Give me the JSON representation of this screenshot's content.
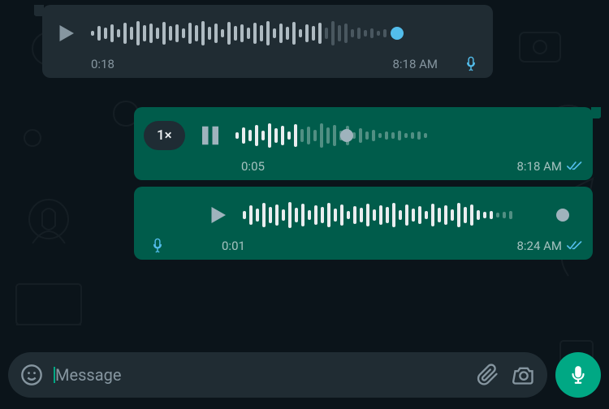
{
  "colors": {
    "incoming_bubble": "#202c33",
    "outgoing_bubble": "#005c4b",
    "bg": "#0b141a",
    "muted_text": "#8696a0",
    "accent": "#00a884",
    "knob_in": "#53bdeb",
    "knob_out_played": "#9fb3bd",
    "tick_read": "#53bdeb"
  },
  "messages": [
    {
      "direction": "incoming",
      "state": "paused",
      "progress": 0.78,
      "duration": "0:18",
      "time": "8:18 AM",
      "heard": true,
      "waveform": [
        6,
        18,
        14,
        22,
        10,
        26,
        16,
        30,
        20,
        24,
        14,
        28,
        18,
        22,
        12,
        26,
        20,
        30,
        16,
        24,
        10,
        28,
        18,
        22,
        14,
        26,
        20,
        30,
        12,
        24,
        16,
        28,
        10,
        22,
        18,
        26,
        14,
        30,
        20,
        24,
        10,
        14,
        8,
        12,
        6,
        10
      ]
    },
    {
      "direction": "outgoing",
      "state": "playing",
      "speed_label": "1×",
      "progress": 0.32,
      "duration": "0:05",
      "time": "8:18 AM",
      "ticks": "read",
      "waveform": [
        8,
        20,
        14,
        26,
        12,
        30,
        18,
        24,
        10,
        28,
        16,
        22,
        14,
        30,
        20,
        26,
        12,
        24,
        8,
        18,
        10,
        14,
        6,
        10,
        8,
        12,
        6,
        8,
        10,
        6
      ]
    },
    {
      "direction": "outgoing",
      "state": "paused",
      "progress": 0.94,
      "duration": "0:01",
      "time": "8:24 AM",
      "ticks": "read",
      "heard": true,
      "waveform": [
        10,
        24,
        16,
        30,
        20,
        26,
        14,
        32,
        18,
        28,
        12,
        24,
        20,
        30,
        16,
        26,
        10,
        22,
        18,
        28,
        14,
        24,
        20,
        30,
        12,
        26,
        16,
        22,
        10,
        28,
        18,
        24,
        14,
        30,
        20,
        26,
        12,
        8,
        10,
        6,
        8,
        10
      ]
    }
  ],
  "input": {
    "placeholder": "Message"
  },
  "icons": {
    "play": "play-icon",
    "pause": "pause-icon",
    "emoji": "emoji-icon",
    "attach": "attachment-icon",
    "camera": "camera-icon",
    "mic": "microphone-icon",
    "mic_heard": "mic-heard-icon",
    "ticks": "double-check-icon"
  }
}
